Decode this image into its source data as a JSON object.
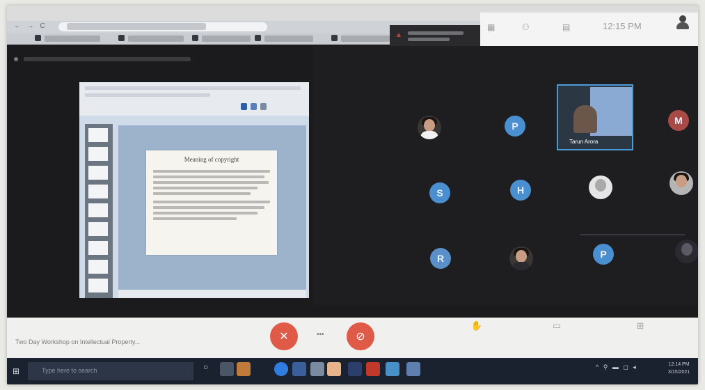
{
  "browser": {
    "nav_icons": "← → C",
    "clock": "12:15 PM"
  },
  "shared_screen": {
    "slide_title": "Meaning of copyright"
  },
  "participants": {
    "tiles": [
      {
        "kind": "photo",
        "color": "#f3f3f3"
      },
      {
        "kind": "initial",
        "letter": "P",
        "color": "#4a8fd0"
      },
      {
        "kind": "video",
        "name": "Tarun Arora"
      },
      {
        "kind": "initial",
        "letter": "M",
        "color": "#a84a46"
      },
      {
        "kind": "initial",
        "letter": "S",
        "color": "#4a8fd0"
      },
      {
        "kind": "initial",
        "letter": "H",
        "color": "#4a8fd0"
      },
      {
        "kind": "photo",
        "color": "#e5e5e5"
      },
      {
        "kind": "photo",
        "color": "#b5b5b5"
      },
      {
        "kind": "initial",
        "letter": "R",
        "color": "#5b8fc9"
      },
      {
        "kind": "photo",
        "color": "#3a3634"
      },
      {
        "kind": "initial",
        "letter": "P",
        "color": "#4a8fd0"
      },
      {
        "kind": "photo",
        "color": "#2a2a30"
      }
    ]
  },
  "meeting": {
    "name": "Two Day Workshop on Intellectual Property...",
    "mic_icon": "mic-off-icon",
    "cam_icon": "camera-off-icon",
    "end_color": "#e05a48"
  },
  "taskbar": {
    "search_placeholder": "Type here to search",
    "time": "12:14 PM",
    "date": "3/15/2021"
  }
}
